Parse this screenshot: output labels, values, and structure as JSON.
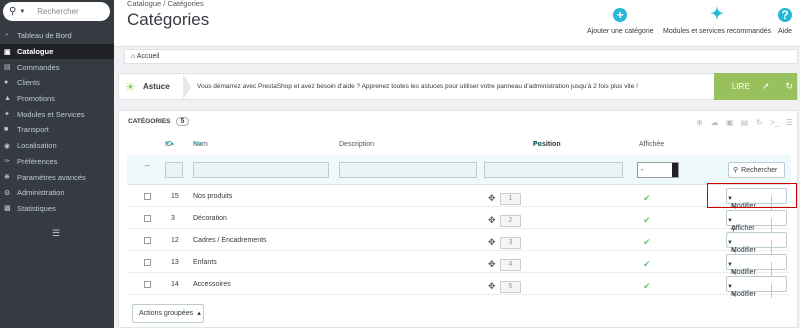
{
  "sidebar": {
    "search_placeholder": "Rechercher",
    "items": [
      {
        "label": "Tableau de Bord",
        "icon": "speedometer-icon"
      },
      {
        "label": "Catalogue",
        "icon": "book-icon",
        "active": true
      },
      {
        "label": "Commandes",
        "icon": "credit-card-icon"
      },
      {
        "label": "Clients",
        "icon": "users-icon"
      },
      {
        "label": "Promotions",
        "icon": "megaphone-icon"
      },
      {
        "label": "Modules et Services",
        "icon": "puzzle-icon"
      },
      {
        "label": "Transport",
        "icon": "truck-icon"
      },
      {
        "label": "Localisation",
        "icon": "globe-icon"
      },
      {
        "label": "Préférences",
        "icon": "wrench-icon"
      },
      {
        "label": "Paramètres avancés",
        "icon": "cogs-icon"
      },
      {
        "label": "Administration",
        "icon": "gear-icon"
      },
      {
        "label": "Statistiques",
        "icon": "bar-chart-icon"
      }
    ]
  },
  "header": {
    "breadcrumb": "Catalogue  /  Catégories",
    "title": "Catégories",
    "buttons": {
      "add": "Ajouter une catégorie",
      "modules": "Modules et services recommandés",
      "help": "Aide"
    }
  },
  "home_link": "Accueil",
  "tip": {
    "label": "Astuce",
    "text": "Vous démarrez avec PrestaShop et avez besoin d'aide ? Apprenez toutes les astuces pour utiliser votre panneau d'administration jusqu'à 2 fois plus vite !",
    "read_button": "LIRE"
  },
  "panel": {
    "title": "Catégories",
    "count": "5",
    "columns": {
      "id": "ID",
      "name": "Nom",
      "description": "Description",
      "position": "Position",
      "displayed": "Affichée"
    },
    "filter_dash": "--",
    "filter_select": "-",
    "search_button": "Rechercher",
    "bulk_button": "Actions groupées",
    "rows": [
      {
        "id": "15",
        "name": "Nos produits",
        "position": "1",
        "action": "Modifier"
      },
      {
        "id": "3",
        "name": "Décoration",
        "position": "2",
        "action": "Afficher"
      },
      {
        "id": "12",
        "name": "Cadres / Encadrements",
        "position": "3",
        "action": "Modifier"
      },
      {
        "id": "13",
        "name": "Enfants",
        "position": "4",
        "action": "Modifier"
      },
      {
        "id": "14",
        "name": "Accessoires",
        "position": "5",
        "action": "Modifier"
      }
    ]
  },
  "colors": {
    "accent": "#25b9d7",
    "sidebar": "#363a41",
    "tip_green": "#98c15e",
    "highlight": "#cc0000"
  }
}
